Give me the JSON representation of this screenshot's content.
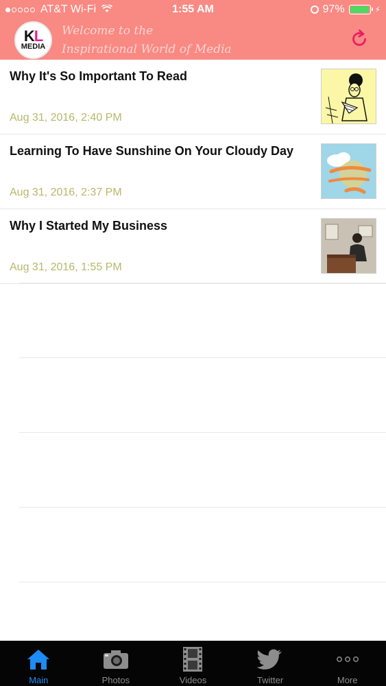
{
  "status_bar": {
    "signal_dots": [
      true,
      false,
      false,
      false,
      false
    ],
    "carrier": "AT&T Wi-Fi",
    "wifi_icon": "wifi-icon",
    "time": "1:55 AM",
    "battery_percent": "97%",
    "battery_level": 0.97,
    "battery_color": "#4cd964"
  },
  "header": {
    "background": "#f98983",
    "logo": {
      "top": "KL",
      "bottom": "MEDIA"
    },
    "welcome_line1": "Welcome to the",
    "welcome_line2": "Inspirational World of Media",
    "refresh_icon": "refresh-icon",
    "refresh_color": "#e91e63"
  },
  "feed": {
    "items": [
      {
        "title": "Why It's So Important To Read",
        "date": "Aug 31, 2016, 2:40 PM"
      },
      {
        "title": "Learning To Have Sunshine On Your Cloudy Day",
        "date": "Aug 31, 2016, 2:37 PM"
      },
      {
        "title": "Why I Started My Business",
        "date": "Aug 31, 2016, 1:55 PM"
      }
    ],
    "date_color": "#b7b769"
  },
  "tabbar": {
    "active_color": "#1c8df5",
    "tabs": [
      {
        "label": "Main",
        "icon": "home-icon",
        "active": true
      },
      {
        "label": "Photos",
        "icon": "camera-icon",
        "active": false
      },
      {
        "label": "Videos",
        "icon": "film-icon",
        "active": false
      },
      {
        "label": "Twitter",
        "icon": "bird-icon",
        "active": false
      },
      {
        "label": "More",
        "icon": "more-icon",
        "active": false
      }
    ]
  }
}
